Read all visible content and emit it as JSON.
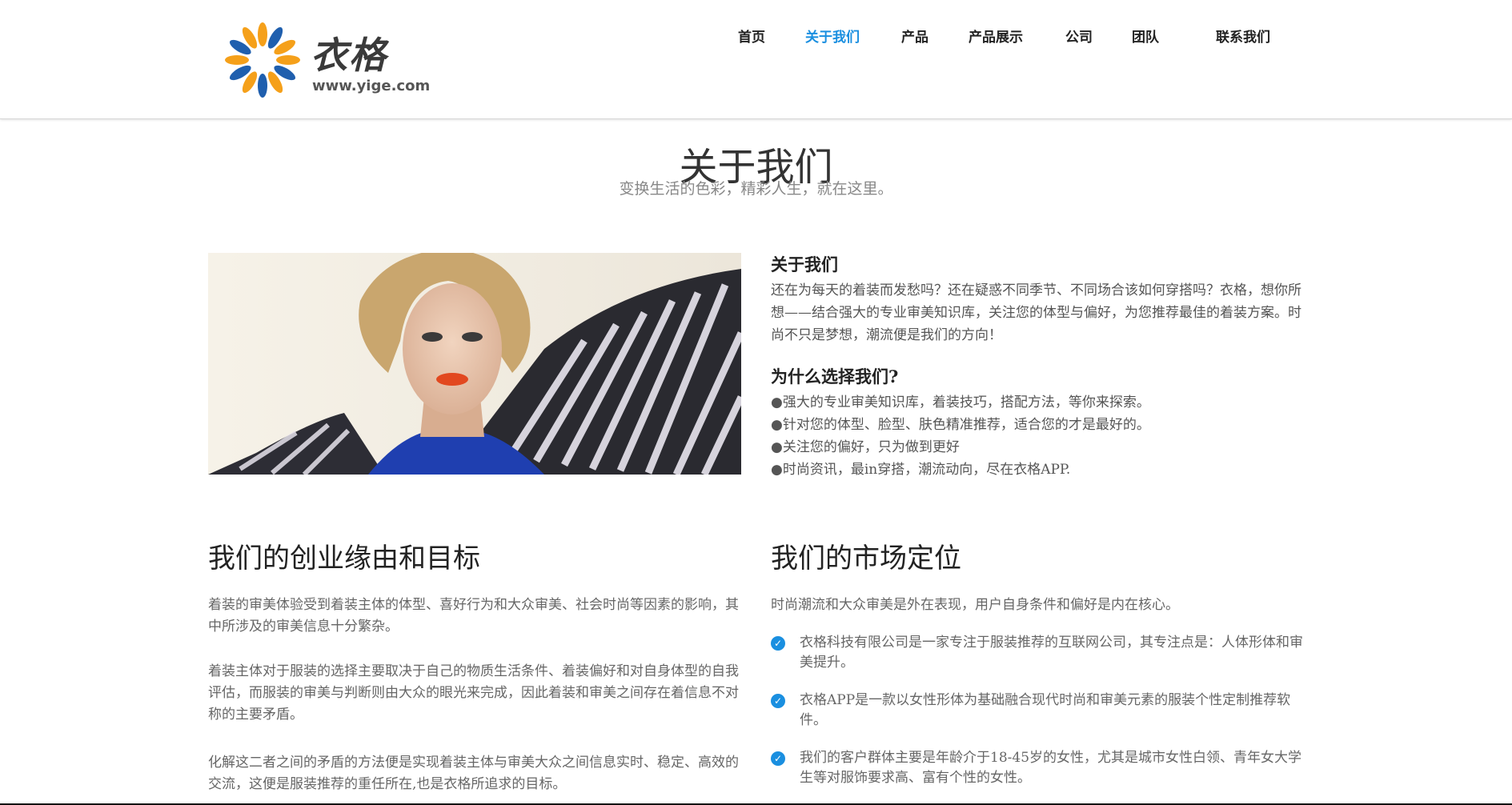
{
  "brand": {
    "name": "衣格",
    "url_text": "www.yige.com"
  },
  "nav": {
    "items": [
      "首页",
      "关于我们",
      "产品",
      "产品展示",
      "公司",
      "团队",
      "联系我们"
    ],
    "active": "关于我们"
  },
  "hero": {
    "title": "关于我们",
    "subtitle": "变换生活的色彩，精彩人生，就在这里。"
  },
  "about": {
    "heading": "关于我们",
    "body": "还在为每天的着装而发愁吗？还在疑惑不同季节、不同场合该如何穿搭吗？衣格，想你所想——结合强大的专业审美知识库，关注您的体型与偏好，为您推荐最佳的着装方案。时尚不只是梦想，潮流便是我们的方向！"
  },
  "why": {
    "heading": "为什么选择我们?",
    "items": [
      "●强大的专业审美知识库，着装技巧，搭配方法，等你来探索。",
      "●针对您的体型、脸型、肤色精准推荐，适合您的才是最好的。",
      "●关注您的偏好，只为做到更好",
      "●时尚资讯，最in穿搭，潮流动向，尽在衣格APP."
    ]
  },
  "origin": {
    "heading": "我们的创业缘由和目标",
    "paragraphs": [
      "着装的审美体验受到着装主体的体型、喜好行为和大众审美、社会时尚等因素的影响，其中所涉及的审美信息十分繁杂。",
      "着装主体对于服装的选择主要取决于自己的物质生活条件、着装偏好和对自身体型的自我评估，而服装的审美与判断则由大众的眼光来完成，因此着装和审美之间存在着信息不对称的主要矛盾。",
      "化解这二者之间的矛盾的方法便是实现着装主体与审美大众之间信息实时、稳定、高效的交流，这便是服装推荐的重任所在,也是衣格所追求的目标。"
    ]
  },
  "market": {
    "heading": "我们的市场定位",
    "intro": "时尚潮流和大众审美是外在表现，用户自身条件和偏好是内在核心。",
    "items": [
      "衣格科技有限公司是一家专注于服装推荐的互联网公司，其专注点是：人体形体和审美提升。",
      "衣格APP是一款以女性形体为基础融合现代时尚和审美元素的服装个性定制推荐软件。",
      "我们的客户群体主要是年龄介于18-45岁的女性，尤其是城市女性白领、青年女大学生等对服饰要求高、富有个性的女性。"
    ]
  },
  "icons": {
    "logo": "sunburst-logo-icon",
    "check": "check-circle-icon"
  },
  "colors": {
    "accent": "#1a8fe0",
    "logo_orange": "#f5a01a",
    "logo_blue": "#1f5fae",
    "text_dark": "#222222",
    "text_muted": "#666666"
  }
}
